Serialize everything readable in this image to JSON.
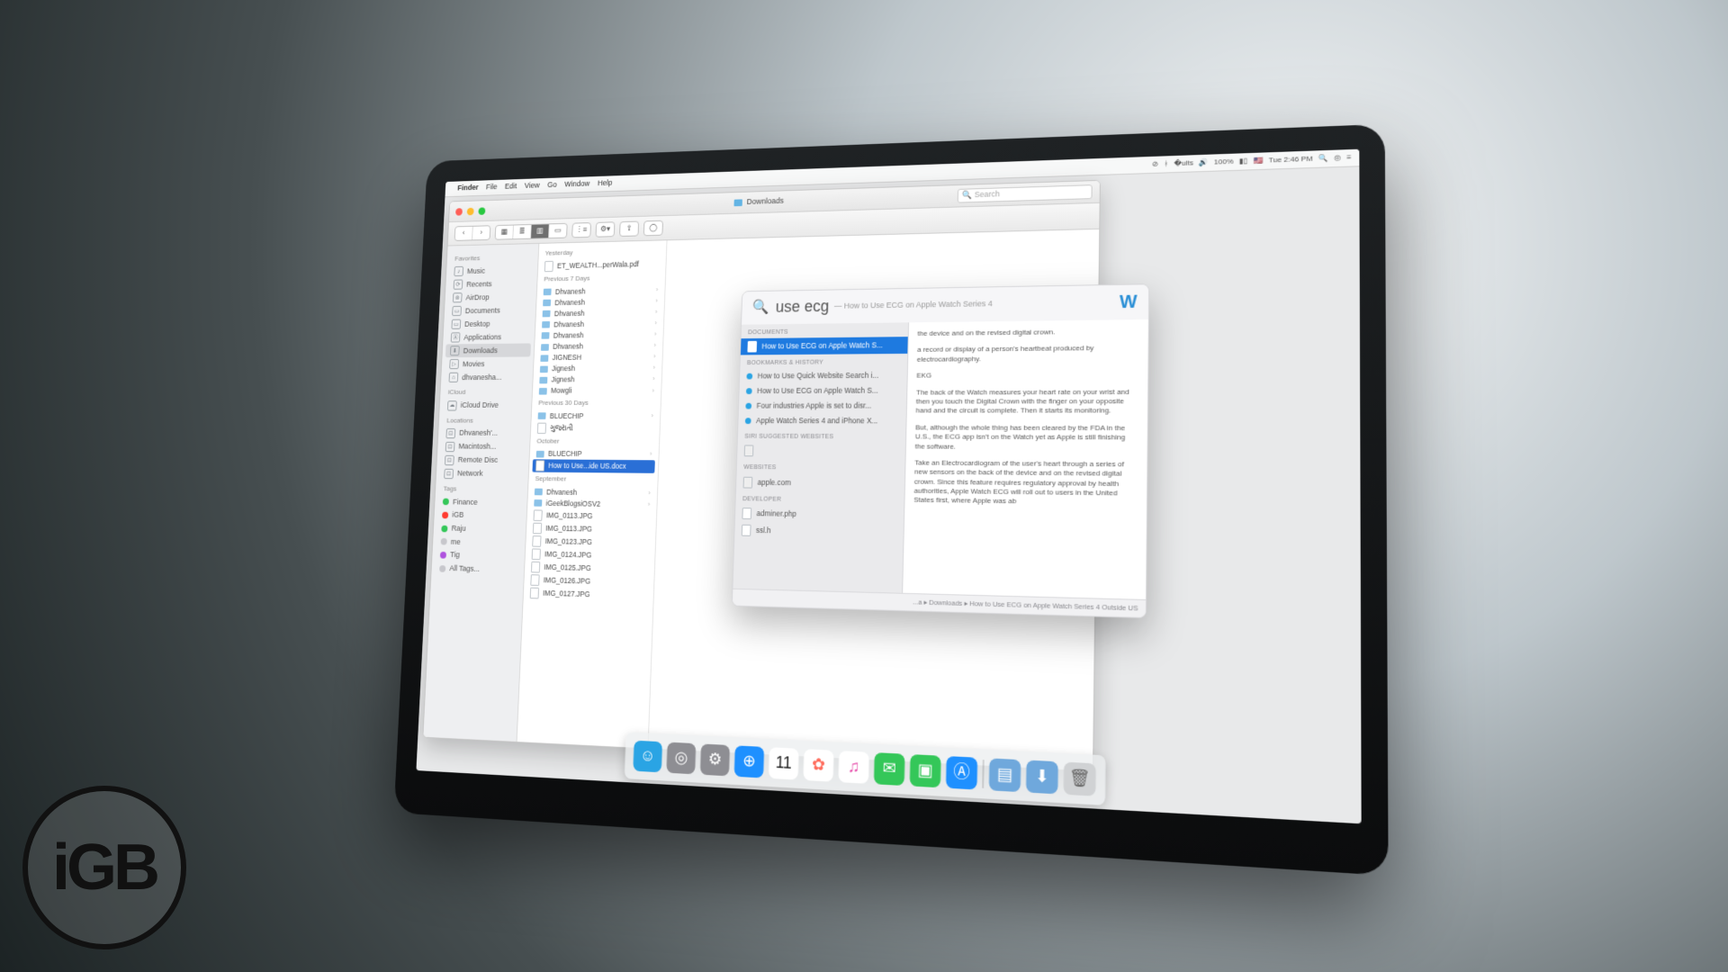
{
  "menubar": {
    "app": "Finder",
    "items": [
      "File",
      "Edit",
      "View",
      "Go",
      "Window",
      "Help"
    ],
    "status": {
      "battery": "100%",
      "clock": "Tue 2:46 PM"
    }
  },
  "finder": {
    "title": "Downloads",
    "search_placeholder": "Search",
    "sidebar": {
      "favorites_h": "Favorites",
      "favorites": [
        "Music",
        "Recents",
        "AirDrop",
        "Documents",
        "Desktop",
        "Applications",
        "Downloads",
        "Movies",
        "dhvanesha..."
      ],
      "icloud_h": "iCloud",
      "icloud": [
        "iCloud Drive"
      ],
      "locations_h": "Locations",
      "locations": [
        "Dhvanesh'...",
        "Macintosh...",
        "Remote Disc",
        "Network"
      ],
      "tags_h": "Tags",
      "tags": [
        {
          "label": "Finance",
          "color": "#34c759"
        },
        {
          "label": "iGB",
          "color": "#ff3b30"
        },
        {
          "label": "Raju",
          "color": "#34c759"
        },
        {
          "label": "me",
          "color": "#c7c7cc"
        },
        {
          "label": "Tig",
          "color": "#af52de"
        },
        {
          "label": "All Tags...",
          "color": "#c7c7cc"
        }
      ]
    },
    "groups": [
      {
        "h": "Yesterday",
        "items": [
          {
            "t": "f",
            "n": "ET_WEALTH...perWala.pdf"
          }
        ]
      },
      {
        "h": "Previous 7 Days",
        "items": [
          {
            "t": "d",
            "n": "Dhvanesh"
          },
          {
            "t": "d",
            "n": "Dhvanesh"
          },
          {
            "t": "d",
            "n": "Dhvanesh"
          },
          {
            "t": "d",
            "n": "Dhvanesh"
          },
          {
            "t": "d",
            "n": "Dhvanesh"
          },
          {
            "t": "d",
            "n": "Dhvanesh"
          },
          {
            "t": "d",
            "n": "JIGNESH"
          },
          {
            "t": "d",
            "n": "Jignesh"
          },
          {
            "t": "d",
            "n": "Jignesh"
          },
          {
            "t": "d",
            "n": "Mowgli"
          }
        ]
      },
      {
        "h": "Previous 30 Days",
        "items": [
          {
            "t": "d",
            "n": "BLUECHIP"
          },
          {
            "t": "f",
            "n": "ગુજરાતી"
          }
        ]
      },
      {
        "h": "October",
        "items": [
          {
            "t": "d",
            "n": "BLUECHIP"
          },
          {
            "t": "f",
            "n": "How to Use...ide US.docx",
            "sel": true
          }
        ]
      },
      {
        "h": "September",
        "items": [
          {
            "t": "d",
            "n": "Dhvanesh"
          },
          {
            "t": "d",
            "n": "iGeekBlogsiOSV2"
          },
          {
            "t": "f",
            "n": "IMG_0113.JPG"
          },
          {
            "t": "f",
            "n": "IMG_0113.JPG"
          },
          {
            "t": "f",
            "n": "IMG_0123.JPG"
          },
          {
            "t": "f",
            "n": "IMG_0124.JPG"
          },
          {
            "t": "f",
            "n": "IMG_0125.JPG"
          },
          {
            "t": "f",
            "n": "IMG_0126.JPG"
          },
          {
            "t": "f",
            "n": "IMG_0127.JPG"
          }
        ]
      }
    ]
  },
  "spotlight": {
    "query": "use ecg",
    "hint": "— How to Use ECG on Apple Watch Series 4",
    "sections": [
      {
        "h": "DOCUMENTS",
        "items": [
          {
            "icon": "d",
            "label": "How to Use ECG on Apple Watch S...",
            "sel": true
          }
        ]
      },
      {
        "h": "BOOKMARKS & HISTORY",
        "items": [
          {
            "icon": "s",
            "label": "How to Use Quick Website Search i..."
          },
          {
            "icon": "s",
            "label": "How to Use ECG on Apple Watch S..."
          },
          {
            "icon": "s",
            "label": "Four industries Apple is set to disr..."
          },
          {
            "icon": "s",
            "label": "Apple Watch Series 4 and iPhone X..."
          }
        ]
      },
      {
        "h": "SIRI SUGGESTED WEBSITES",
        "items": [
          {
            "icon": "b",
            "label": ""
          }
        ]
      },
      {
        "h": "WEBSITES",
        "items": [
          {
            "icon": "b",
            "label": "apple.com"
          }
        ]
      },
      {
        "h": "DEVELOPER",
        "items": [
          {
            "icon": "d",
            "label": "adminer.php"
          },
          {
            "icon": "d",
            "label": "ssl.h"
          }
        ]
      }
    ],
    "preview": {
      "p1": "the device and on the revised digital crown.",
      "p2": "a record or display of a person's heartbeat produced by electrocardiography.",
      "p3": "EKG",
      "p4": "The back of the Watch measures your heart rate on your wrist and then you touch the Digital Crown with the finger on your opposite hand and the circuit is complete. Then it starts its monitoring.",
      "p5": "But, although the whole thing has been cleared by the FDA in the U.S., the ECG app isn't on the Watch yet as Apple is still finishing the software.",
      "p6": "Take an Electrocardiogram of the user's heart through a series of new sensors on the back of the device and on the revised digital crown. Since this feature requires regulatory approval by health authorities, Apple Watch ECG will roll out to users in the United States first, where Apple was ab"
    },
    "foot": "...a ▸ Downloads ▸ How to Use ECG on Apple Watch Series 4 Outside US"
  },
  "dock": [
    {
      "name": "finder",
      "bg": "#2aa4e4",
      "glyph": "☺"
    },
    {
      "name": "launchpad",
      "bg": "#8e8e93",
      "glyph": "◎"
    },
    {
      "name": "settings",
      "bg": "#8e8e93",
      "glyph": "⚙"
    },
    {
      "name": "safari",
      "bg": "#1e90ff",
      "glyph": "⊕"
    },
    {
      "name": "calendar",
      "bg": "#ffffff",
      "glyph": "11",
      "fg": "#222"
    },
    {
      "name": "photos",
      "bg": "#ffffff",
      "glyph": "✿",
      "fg": "#ff6b5b"
    },
    {
      "name": "itunes",
      "bg": "#fff",
      "glyph": "♫",
      "fg": "#e64aa9"
    },
    {
      "name": "messages",
      "bg": "#34c759",
      "glyph": "✉"
    },
    {
      "name": "facetime",
      "bg": "#34c759",
      "glyph": "▣"
    },
    {
      "name": "appstore",
      "bg": "#1e90ff",
      "glyph": "Ⓐ"
    },
    {
      "name": "sep"
    },
    {
      "name": "preview",
      "bg": "#6fa8dc",
      "glyph": "▤"
    },
    {
      "name": "downloads",
      "bg": "#6fa8dc",
      "glyph": "⬇"
    },
    {
      "name": "trash",
      "bg": "#d0d2d4",
      "glyph": "🗑",
      "fg": "#666"
    }
  ]
}
